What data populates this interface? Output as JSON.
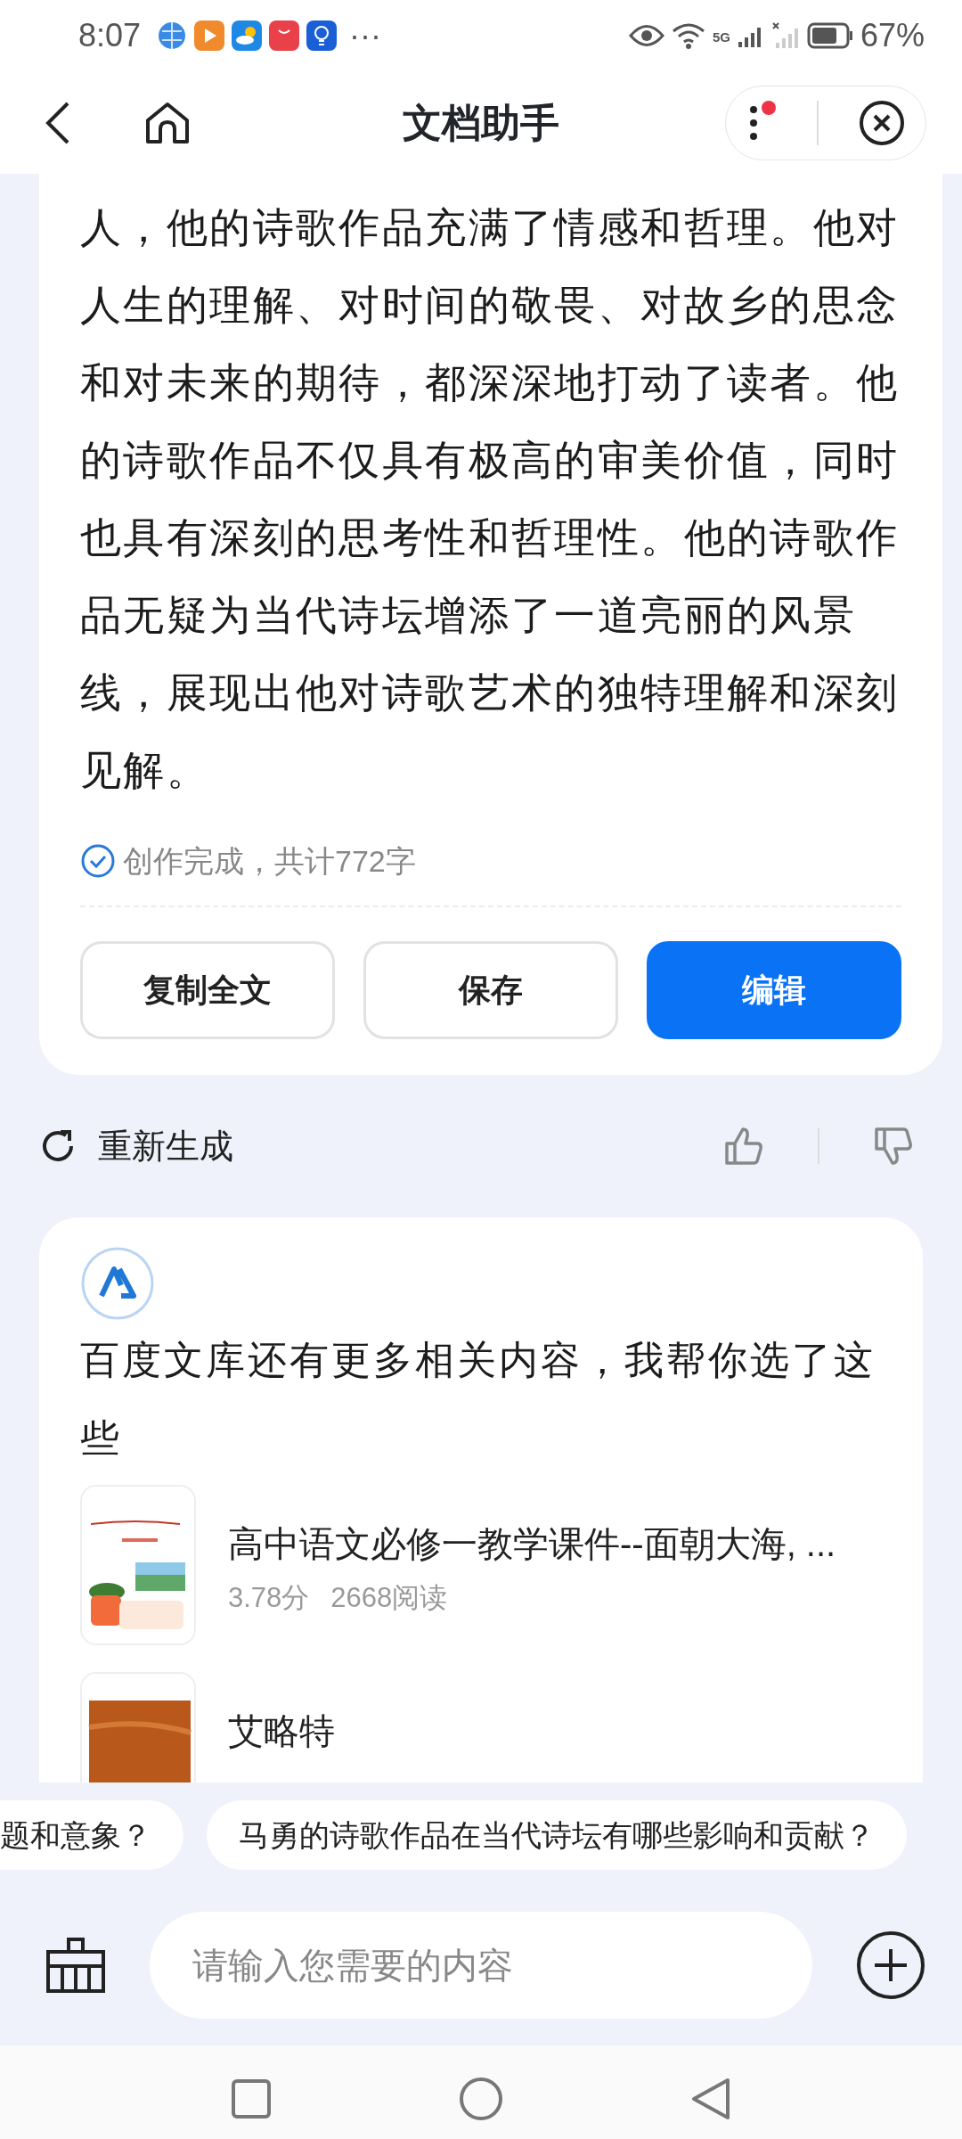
{
  "status_bar": {
    "time": "8:07",
    "more": "···",
    "network": "5G",
    "battery": "67%"
  },
  "header": {
    "title": "文档助手",
    "menu_badge": true
  },
  "answer": {
    "text": "人，他的诗歌作品充满了情感和哲理。他对人生的理解、对时间的敬畏、对故乡的思念和对未来的期待，都深深地打动了读者。他的诗歌作品不仅具有极高的审美价值，同时也具有深刻的思考性和哲理性。他的诗歌作品无疑为当代诗坛增添了一道亮丽的风景线，展现出他对诗歌艺术的独特理解和深刻见解。",
    "status": "创作完成，共计772字",
    "buttons": [
      {
        "label": "复制全文",
        "primary": false
      },
      {
        "label": "保存",
        "primary": false
      },
      {
        "label": "编辑",
        "primary": true
      }
    ]
  },
  "feedback": {
    "regenerate": "重新生成"
  },
  "recommendations": {
    "intro": "百度文库还有更多相关内容，我帮你选了这些",
    "docs": [
      {
        "title": "高中语文必修一教学课件--面朝大海, ...",
        "score": "3.78分",
        "reads": "2668阅读"
      },
      {
        "title": "艾略特"
      }
    ]
  },
  "suggestions": [
    "题和意象？",
    "马勇的诗歌作品在当代诗坛有哪些影响和贡献？"
  ],
  "input": {
    "placeholder": "请输入您需要的内容"
  }
}
